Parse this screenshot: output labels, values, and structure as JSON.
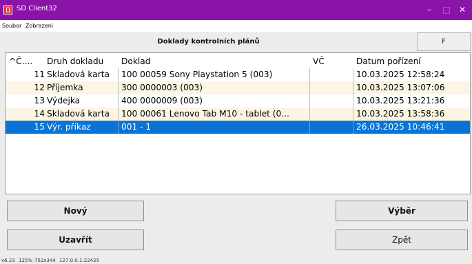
{
  "window": {
    "title": "SD Client32",
    "minimize_glyph": "–",
    "maximize_glyph": "□",
    "close_glyph": "✕"
  },
  "menu": {
    "items": [
      "Soubor",
      "Zobrazeni"
    ]
  },
  "header": {
    "title": "Doklady kontrolních plánů",
    "f_button": "F"
  },
  "table": {
    "columns": [
      "^Č....",
      "Druh dokladu",
      "Doklad",
      "VČ",
      "Datum pořízení"
    ],
    "rows": [
      {
        "no": "11",
        "type": "Skladová karta",
        "doc": "100 00059 Sony Playstation 5 (003)",
        "vc": "",
        "date": "10.03.2025 12:58:24"
      },
      {
        "no": "12",
        "type": "Příjemka",
        "doc": "300 0000003 (003)",
        "vc": "",
        "date": "10.03.2025 13:07:06"
      },
      {
        "no": "13",
        "type": "Výdejka",
        "doc": "400 0000009 (003)",
        "vc": "",
        "date": "10.03.2025 13:21:36"
      },
      {
        "no": "14",
        "type": "Skladová karta",
        "doc": "100 00061 Lenovo Tab M10 - tablet (0...",
        "vc": "",
        "date": "10.03.2025 13:58:36"
      },
      {
        "no": "15",
        "type": "Výr. příkaz",
        "doc": "001 - 1",
        "vc": "",
        "date": "26.03.2025 10:46:41"
      }
    ],
    "selected_row": "15"
  },
  "buttons": {
    "new": "Nový",
    "close": "Uzavřít",
    "select": "Výběr",
    "back": "Zpět"
  },
  "status": {
    "version": "v6.23",
    "zoom": "125%",
    "size": "752x344",
    "address": "127.0.0.1:22425"
  }
}
